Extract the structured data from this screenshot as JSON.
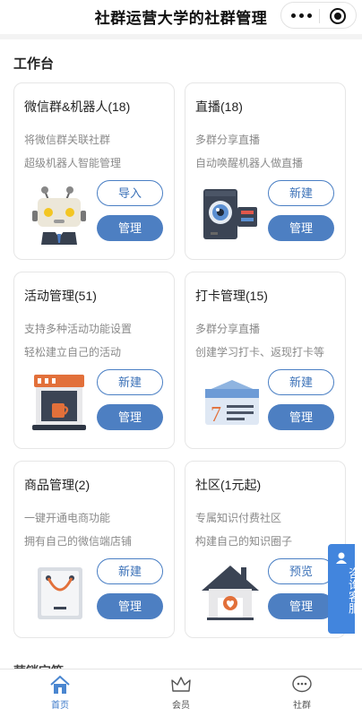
{
  "nav": {
    "title": "社群运营大学的社群管理",
    "more_icon": "more-dots-icon",
    "close_icon": "target-close-icon"
  },
  "workspace": {
    "title": "工作台",
    "cards": [
      {
        "title": "微信群&机器人(18)",
        "desc1": "将微信群关联社群",
        "desc2": "超级机器人智能管理",
        "icon": "robot-icon",
        "action_label": "导入",
        "manage_label": "管理"
      },
      {
        "title": "直播(18)",
        "desc1": "多群分享直播",
        "desc2": "自动唤醒机器人做直播",
        "icon": "camera-icon",
        "action_label": "新建",
        "manage_label": "管理"
      },
      {
        "title": "活动管理(51)",
        "desc1": "支持多种活动功能设置",
        "desc2": "轻松建立自己的活动",
        "icon": "coffee-machine-icon",
        "action_label": "新建",
        "manage_label": "管理"
      },
      {
        "title": "打卡管理(15)",
        "desc1": "多群分享直播",
        "desc2": "创建学习打卡、返现打卡等",
        "icon": "checkin-card-icon",
        "action_label": "新建",
        "manage_label": "管理"
      },
      {
        "title": "商品管理(2)",
        "desc1": "一键开通电商功能",
        "desc2": "拥有自己的微信端店铺",
        "icon": "shopping-bag-icon",
        "action_label": "新建",
        "manage_label": "管理"
      },
      {
        "title": "社区(1元起)",
        "desc1": "专属知识付费社区",
        "desc2": "构建自己的知识圈子",
        "icon": "house-heart-icon",
        "action_label": "预览",
        "manage_label": "管理"
      }
    ]
  },
  "next_section": {
    "title": "营销宝箱"
  },
  "float_service": {
    "label": "咨询客服",
    "icon": "headset-icon"
  },
  "tabbar": {
    "items": [
      {
        "label": "首页",
        "icon": "home-icon",
        "active": true
      },
      {
        "label": "会员",
        "icon": "crown-icon",
        "active": false
      },
      {
        "label": "社群",
        "icon": "chat-bubble-icon",
        "active": false
      }
    ]
  },
  "colors": {
    "accent": "#4d7fc2",
    "float_button": "#4285dd",
    "active_tab": "#3c79c9"
  }
}
